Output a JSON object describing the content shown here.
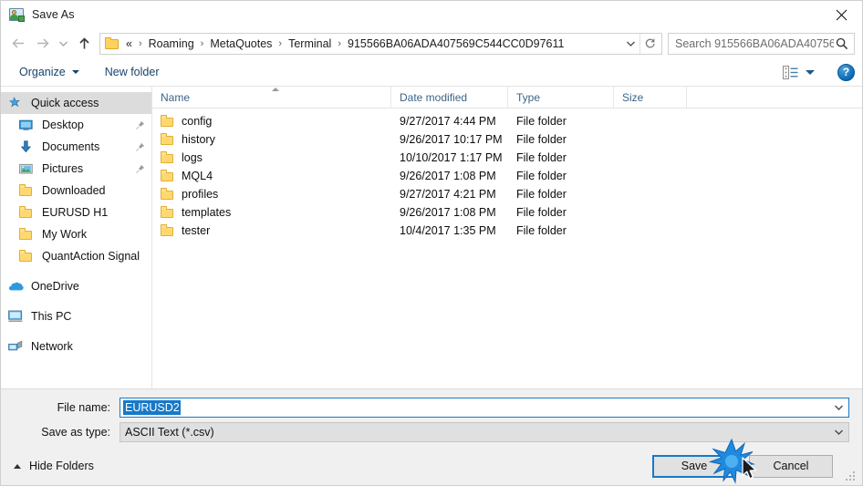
{
  "window": {
    "title": "Save As",
    "icon": "save-as-app-icon",
    "close_label": "✕"
  },
  "nav": {
    "back": "back-arrow",
    "forward": "forward-arrow",
    "recent": "recent-locations-chevron",
    "up": "up-arrow",
    "breadcrumbs": [
      {
        "label": "«"
      },
      {
        "label": "Roaming"
      },
      {
        "label": "MetaQuotes"
      },
      {
        "label": "Terminal"
      },
      {
        "label": "915566BA06ADA407569C544CC0D97611"
      }
    ],
    "separator": "›",
    "refresh": "refresh-icon",
    "dropdown": "chevron-down-icon"
  },
  "search": {
    "placeholder": "Search 915566BA06ADA40756...",
    "icon": "search-icon"
  },
  "toolbar": {
    "organize": "Organize",
    "new_folder": "New folder",
    "view_icon": "view-layout-icon",
    "help": "?"
  },
  "sidebar": {
    "items": [
      {
        "label": "Quick access",
        "icon": "star-icon",
        "selected": true,
        "pinned": false,
        "indent": false
      },
      {
        "label": "Desktop",
        "icon": "monitor-icon",
        "selected": false,
        "pinned": true,
        "indent": true
      },
      {
        "label": "Documents",
        "icon": "download-arrow-icon",
        "selected": false,
        "pinned": true,
        "indent": true
      },
      {
        "label": "Pictures",
        "icon": "picture-icon",
        "selected": false,
        "pinned": true,
        "indent": true
      },
      {
        "label": "Downloaded",
        "icon": "folder-icon",
        "selected": false,
        "pinned": false,
        "indent": true
      },
      {
        "label": "EURUSD H1",
        "icon": "folder-icon",
        "selected": false,
        "pinned": false,
        "indent": true
      },
      {
        "label": "My Work",
        "icon": "folder-icon",
        "selected": false,
        "pinned": false,
        "indent": true
      },
      {
        "label": "QuantAction Signal",
        "icon": "folder-icon",
        "selected": false,
        "pinned": false,
        "indent": true
      },
      {
        "label": "OneDrive",
        "icon": "cloud-icon",
        "selected": false,
        "pinned": false,
        "indent": false,
        "gap_before": true
      },
      {
        "label": "This PC",
        "icon": "pc-icon",
        "selected": false,
        "pinned": false,
        "indent": false,
        "gap_before": true
      },
      {
        "label": "Network",
        "icon": "network-icon",
        "selected": false,
        "pinned": false,
        "indent": false,
        "gap_before": true
      }
    ]
  },
  "filelist": {
    "columns": [
      "Name",
      "Date modified",
      "Type",
      "Size"
    ],
    "sort_column": "Name",
    "sort_direction": "ascending",
    "rows": [
      {
        "name": "config",
        "date": "9/27/2017 4:44 PM",
        "type": "File folder",
        "size": ""
      },
      {
        "name": "history",
        "date": "9/26/2017 10:17 PM",
        "type": "File folder",
        "size": ""
      },
      {
        "name": "logs",
        "date": "10/10/2017 1:17 PM",
        "type": "File folder",
        "size": ""
      },
      {
        "name": "MQL4",
        "date": "9/26/2017 1:08 PM",
        "type": "File folder",
        "size": ""
      },
      {
        "name": "profiles",
        "date": "9/27/2017 4:21 PM",
        "type": "File folder",
        "size": ""
      },
      {
        "name": "templates",
        "date": "9/26/2017 1:08 PM",
        "type": "File folder",
        "size": ""
      },
      {
        "name": "tester",
        "date": "10/4/2017 1:35 PM",
        "type": "File folder",
        "size": ""
      }
    ]
  },
  "form": {
    "filename_label": "File name:",
    "filename_value": "EURUSD2",
    "savetype_label": "Save as type:",
    "savetype_value": "ASCII Text (*.csv)"
  },
  "footer": {
    "hide_folders": "Hide Folders",
    "save": "Save",
    "cancel": "Cancel"
  },
  "colors": {
    "accent": "#1779c8",
    "selection": "#1779c8",
    "folder": "#ffd970",
    "link_text": "#16446b",
    "sidebar_selected": "#dcdcdc",
    "dialog_bg": "#f0f0f0"
  }
}
